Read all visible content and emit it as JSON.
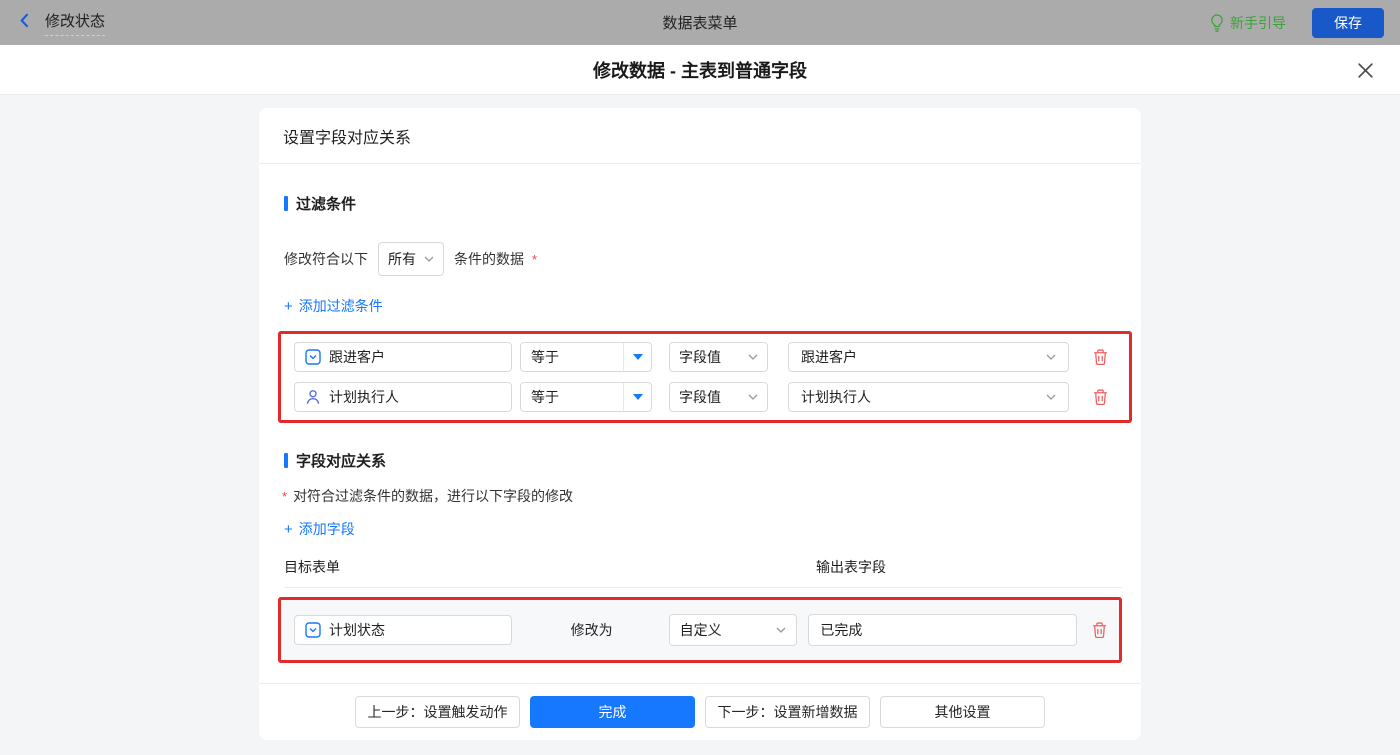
{
  "icons": {
    "plus": "+"
  },
  "colors": {
    "accent_blue": "#1677ff",
    "save_button_blue": "#1958c8",
    "guide_green": "#3da238",
    "highlight_red": "#e02b2b",
    "trash_red": "#f06060",
    "asterisk_red": "#f53f3f",
    "topbar_gray": "#ababab"
  },
  "topbar": {
    "page_name": "修改状态",
    "center_title": "数据表菜单",
    "guide_label": "新手引导",
    "save_label": "保存"
  },
  "dialog": {
    "title": "修改数据 - 主表到普通字段"
  },
  "card": {
    "header": "设置字段对应关系",
    "filter_section": {
      "title": "过滤条件",
      "match_prefix": "修改符合以下",
      "match_select_value": "所有",
      "match_suffix": "条件的数据",
      "required_mark": "*",
      "add_link": "添加过滤条件",
      "rows": [
        {
          "field_icon": "select-field-icon",
          "field": "跟进客户",
          "operator": "等于",
          "value_type": "字段值",
          "value": "跟进客户"
        },
        {
          "field_icon": "user-field-icon",
          "field": "计划执行人",
          "operator": "等于",
          "value_type": "字段值",
          "value": "计划执行人"
        }
      ]
    },
    "mapping_section": {
      "title": "字段对应关系",
      "required_mark": "*",
      "description": "对符合过滤条件的数据，进行以下字段的修改",
      "add_link": "添加字段",
      "col_target": "目标表单",
      "col_output": "输出表字段",
      "rows": [
        {
          "field_icon": "select-field-icon",
          "field": "计划状态",
          "modify_label": "修改为",
          "mode": "自定义",
          "value": "已完成"
        }
      ]
    },
    "footer": {
      "prev_label": "上一步：设置触发动作",
      "done_label": "完成",
      "next_label": "下一步：设置新增数据",
      "other_label": "其他设置"
    }
  }
}
